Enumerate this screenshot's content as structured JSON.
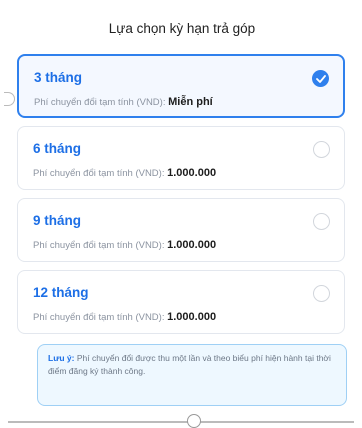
{
  "sheet": {
    "title": "Lựa chọn kỳ hạn trả góp"
  },
  "options": [
    {
      "label": "3 tháng",
      "fee_label": "Phí chuyển đổi tạm tính (VND):",
      "fee_value": "Miễn phí",
      "selected": true
    },
    {
      "label": "6 tháng",
      "fee_label": "Phí chuyển đổi tạm tính (VND):",
      "fee_value": "1.000.000",
      "selected": false
    },
    {
      "label": "9 tháng",
      "fee_label": "Phí chuyển đổi tạm tính (VND):",
      "fee_value": "1.000.000",
      "selected": false
    },
    {
      "label": "12 tháng",
      "fee_label": "Phí chuyển đổi tạm tính (VND):",
      "fee_value": "1.000.000",
      "selected": false
    }
  ],
  "note": {
    "label": "Lưu ý:",
    "text": " Phí chuyển đổi được thu một lần và theo biểu phí hiện hành tại thời điểm đăng ký thành công."
  },
  "colors": {
    "accent": "#2f80ed",
    "option_title": "#1d6fe6",
    "note_bg": "#eef8ff",
    "note_border": "#9fd0f5"
  },
  "icons": {
    "selected_radio": "check-circle-icon",
    "unselected_radio": "empty-circle-icon"
  }
}
